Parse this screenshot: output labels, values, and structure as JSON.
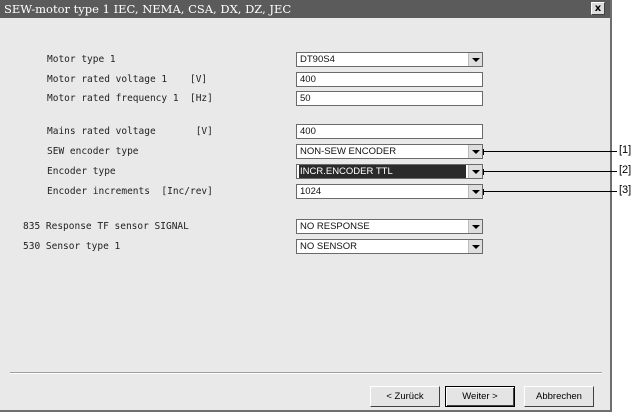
{
  "window": {
    "title": "SEW-motor type 1 IEC, NEMA, CSA, DX, DZ, JEC",
    "close_label": "x"
  },
  "fields": {
    "motor_type": {
      "label": "Motor type 1",
      "value": "DT90S4"
    },
    "rated_voltage": {
      "label": "Motor rated voltage 1    [V]",
      "value": "400"
    },
    "rated_frequency": {
      "label": "Motor rated frequency 1  [Hz]",
      "value": "50"
    },
    "mains_voltage": {
      "label": "Mains rated voltage       [V]",
      "value": "400"
    },
    "sew_encoder_type": {
      "label": "SEW encoder type",
      "value": "NON-SEW ENCODER"
    },
    "encoder_type": {
      "label": "Encoder type",
      "value": "INCR.ENCODER TTL"
    },
    "encoder_increments": {
      "label": "Encoder increments  [Inc/rev]",
      "value": "1024"
    },
    "tf_sensor": {
      "label": "835 Response TF sensor SIGNAL",
      "value": "NO RESPONSE"
    },
    "sensor_type": {
      "label": "530 Sensor type 1",
      "value": "NO SENSOR"
    }
  },
  "callouts": [
    "[1]",
    "[2]",
    "[3]"
  ],
  "buttons": {
    "back": "< Zurück",
    "next": "Weiter >",
    "cancel": "Abbrechen"
  }
}
